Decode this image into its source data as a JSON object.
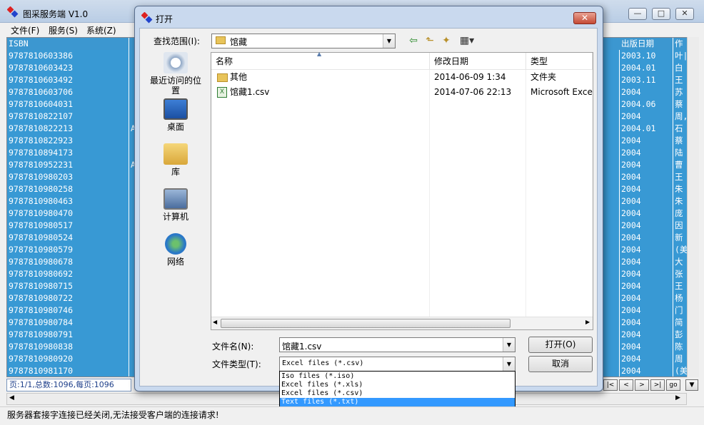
{
  "app": {
    "title": "图采服务端 V1.0",
    "min": "—",
    "max": "□",
    "close": "✕"
  },
  "menu": [
    "文件(F)",
    "服务(S)",
    "系统(Z)"
  ],
  "grid": {
    "headers": [
      "ISBN",
      "出版日期",
      "作"
    ],
    "rows": [
      {
        "isbn": "9787810603386",
        "c": "",
        "date": "2003.10",
        "author": "叶|"
      },
      {
        "isbn": "9787810603423",
        "c": "",
        "date": "2004.01",
        "author": "白"
      },
      {
        "isbn": "9787810603492",
        "c": "",
        "date": "2003.11",
        "author": "王"
      },
      {
        "isbn": "9787810603706",
        "c": "",
        "date": "2004",
        "author": "苏"
      },
      {
        "isbn": "9787810604031",
        "c": "",
        "date": "2004.06",
        "author": "蔡"
      },
      {
        "isbn": "9787810822107",
        "c": "",
        "date": "2004",
        "author": "周,"
      },
      {
        "isbn": "9787810822213",
        "c": "A",
        "date": "2004.01",
        "author": "石"
      },
      {
        "isbn": "9787810822923",
        "c": "",
        "date": "2004",
        "author": "蔡"
      },
      {
        "isbn": "9787810894173",
        "c": "",
        "date": "2004",
        "author": "陆"
      },
      {
        "isbn": "9787810952231",
        "c": "A",
        "date": "2004",
        "author": "曹"
      },
      {
        "isbn": "9787810980203",
        "c": "",
        "date": "2004",
        "author": "王"
      },
      {
        "isbn": "9787810980258",
        "c": "",
        "date": "2004",
        "author": "朱"
      },
      {
        "isbn": "9787810980463",
        "c": "",
        "date": "2004",
        "author": "朱"
      },
      {
        "isbn": "9787810980470",
        "c": "",
        "date": "2004",
        "author": "庞"
      },
      {
        "isbn": "9787810980517",
        "c": "",
        "date": "2004",
        "author": "因"
      },
      {
        "isbn": "9787810980524",
        "c": "",
        "date": "2004",
        "author": "新"
      },
      {
        "isbn": "9787810980579",
        "c": "",
        "date": "2004",
        "author": "(美"
      },
      {
        "isbn": "9787810980678",
        "c": "",
        "date": "2004",
        "author": "大"
      },
      {
        "isbn": "9787810980692",
        "c": "",
        "date": "2004",
        "author": "张"
      },
      {
        "isbn": "9787810980715",
        "c": "",
        "date": "2004",
        "author": "王"
      },
      {
        "isbn": "9787810980722",
        "c": "",
        "date": "2004",
        "author": "杨"
      },
      {
        "isbn": "9787810980746",
        "c": "",
        "date": "2004",
        "author": "门"
      },
      {
        "isbn": "9787810980784",
        "c": "",
        "date": "2004",
        "author": "简"
      },
      {
        "isbn": "9787810980791",
        "c": "",
        "date": "2004",
        "author": "彭"
      },
      {
        "isbn": "9787810980838",
        "c": "",
        "date": "2004",
        "author": "陈"
      },
      {
        "isbn": "9787810980920",
        "c": "",
        "date": "2004",
        "author": "周"
      },
      {
        "isbn": "9787810981170",
        "c": "",
        "date": "2004",
        "author": "(美"
      }
    ]
  },
  "pager": {
    "info": "页:1/1,总数:1096,每页:1096",
    "go": "go"
  },
  "status": "服务器套接字连接已经关闭,无法接受客户端的连接请求!",
  "dialog": {
    "title": "打开",
    "look_in_label": "查找范围(I):",
    "look_in_value": "馆藏",
    "places": [
      "最近访问的位置",
      "桌面",
      "库",
      "计算机",
      "网络"
    ],
    "columns": [
      "名称",
      "修改日期",
      "类型"
    ],
    "files": [
      {
        "name": "其他",
        "date": "2014-06-09 1:34",
        "type": "文件夹"
      },
      {
        "name": "馆藏1.csv",
        "date": "2014-07-06 22:13",
        "type": "Microsoft Excel"
      }
    ],
    "filename_label": "文件名(N):",
    "filename_value": "馆藏1.csv",
    "filetype_label": "文件类型(T):",
    "filetype_value": "Excel files (*.csv)",
    "open_button": "打开(O)",
    "cancel_button": "取消",
    "type_options": [
      "Iso files (*.iso)",
      "Excel files (*.xls)",
      "Excel files (*.csv)",
      "Text files (*.txt)"
    ]
  },
  "colors": {
    "grid_row": "#3899d4",
    "selection": "#3399ff",
    "title_bar": "#c9d9ee"
  }
}
